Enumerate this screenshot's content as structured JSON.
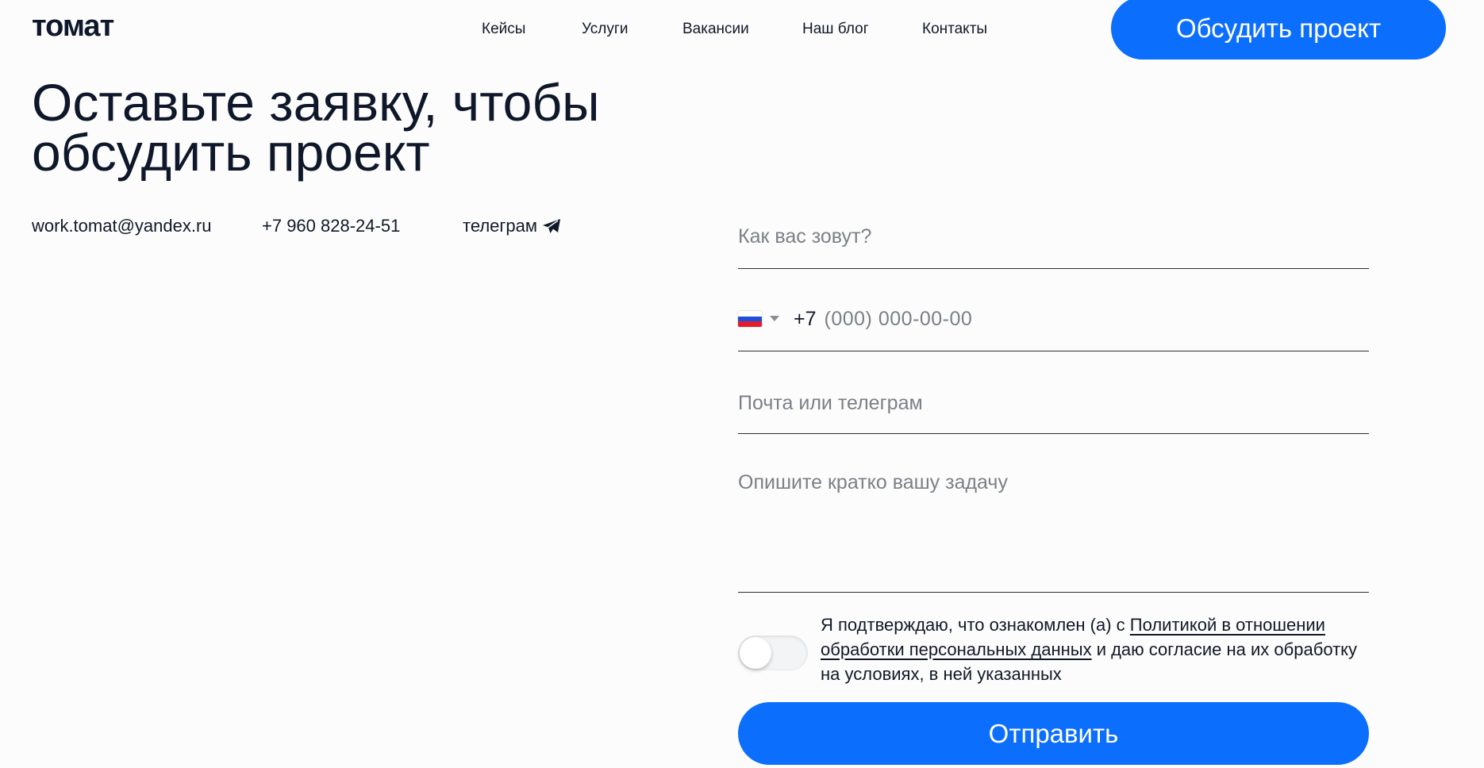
{
  "header": {
    "logo": "томат",
    "nav": [
      "Кейсы",
      "Услуги",
      "Вакансии",
      "Наш блог",
      "Контакты"
    ],
    "cta_label": "Обсудить проект"
  },
  "hero": {
    "title": "Оставьте заявку, чтобы обсудить проект"
  },
  "contacts": {
    "email": "work.tomat@yandex.ru",
    "phone": "+7 960 828-24-51",
    "telegram": "телеграм",
    "telegram_icon": "paper-plane-icon"
  },
  "form": {
    "name_placeholder": "Как вас зовут?",
    "phone_country": "RU",
    "phone_code": "+7",
    "phone_placeholder": "(000) 000-00-00",
    "contact_placeholder": "Почта или телеграм",
    "task_placeholder": "Опишите кратко вашу задачу",
    "consent_checked": false,
    "consent_before": "Я подтверждаю, что ознакомлен (а) с ",
    "consent_link": "Политикой в отношении обработки персональных данных",
    "consent_after": " и даю согласие на их обработку на условиях, в ней указанных",
    "submit_label": "Отправить"
  },
  "colors": {
    "accent": "#0c6efd",
    "background": "#fcfcfc",
    "text": "#111827"
  }
}
